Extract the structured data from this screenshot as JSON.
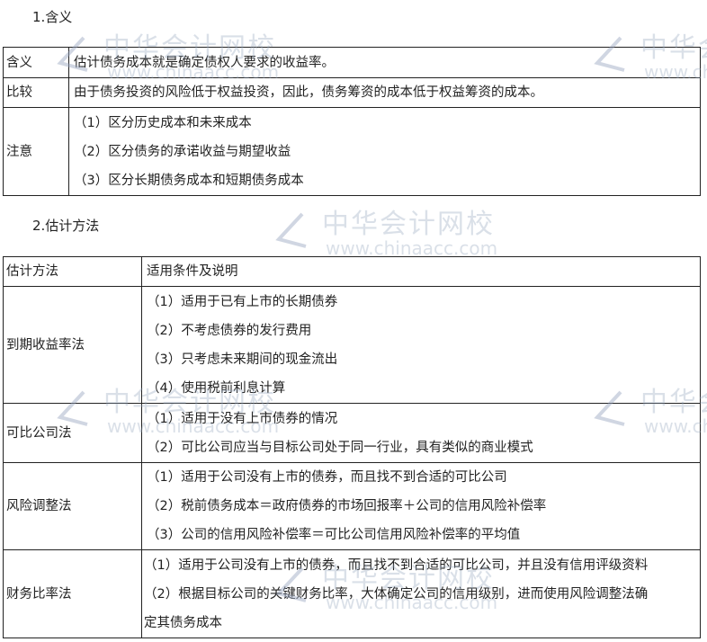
{
  "watermark": {
    "name": "中华会计网校",
    "url": "www.chinaacc.com"
  },
  "section1": {
    "title": "1.含义",
    "rows": [
      {
        "label": "含义",
        "lines": [
          "估计债务成本就是确定债权人要求的收益率。"
        ]
      },
      {
        "label": "比较",
        "lines": [
          "由于债务投资的风险低于权益投资，因此，债务筹资的成本低于权益筹资的成本。"
        ]
      },
      {
        "label": "注意",
        "lines": [
          "（1）区分历史成本和未来成本",
          "（2）区分债务的承诺收益与期望收益",
          "（3）区分长期债务成本和短期债务成本"
        ]
      }
    ]
  },
  "section2": {
    "title": "2.估计方法",
    "header": [
      "估计方法",
      "适用条件及说明"
    ],
    "rows": [
      {
        "label": "到期收益率法",
        "lines": [
          "（1）适用于已有上市的长期债券",
          "（2）不考虑债券的发行费用",
          "（3）只考虑未来期间的现金流出",
          "（4）使用税前利息计算"
        ]
      },
      {
        "label": "可比公司法",
        "lines": [
          "（1）适用于没有上市债券的情况",
          "（2）可比公司应当与目标公司处于同一行业，具有类似的商业模式"
        ]
      },
      {
        "label": "风险调整法",
        "lines": [
          "（1）适用于公司没有上市的债券，而且找不到合适的可比公司",
          "（2）税前债务成本＝政府债券的市场回报率＋公司的信用风险补偿率",
          "（3）公司的信用风险补偿率＝可比公司信用风险补偿率的平均值"
        ]
      },
      {
        "label": "财务比率法",
        "lines": [
          "（1）适用于公司没有上市的债券，而且找不到合适的可比公司，并且没有信用评级资料",
          "（2）根据目标公司的关键财务比率，大体确定公司的信用级别，进而使用风险调整法确",
          "定其债务成本"
        ]
      }
    ]
  }
}
